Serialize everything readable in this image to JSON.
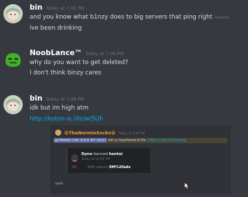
{
  "messages": [
    {
      "author": "bin",
      "timestamp": "Today at 7:06 PM",
      "lines": [
        "and you know what b1nzy does to big servers that ping right",
        "ive been drinking"
      ],
      "edited_label": "(edited)"
    },
    {
      "author": "NoobLance™",
      "timestamp": "Today at 7:06 PM",
      "lines": [
        "why do you want to get deleted?",
        "I don't think binzy cares"
      ]
    },
    {
      "author": "bin",
      "timestamp": "Today at 7:06 PM",
      "lines": [
        "idk but im high atm"
      ],
      "link": "http://koton-is.life/wi5Uh"
    }
  ],
  "embed": {
    "author": "TheNormieSocks",
    "author_emoji_left": "😀",
    "author_emoji_right": "😀",
    "timestamp": "Today at 7:07 PM",
    "highlight_mention": "@DRAMA CAN SUCK MY DICK!",
    "highlight_text": " tell ur boyfriend to fix",
    "highlight_link": "https://i.bin.tv/2i4.png",
    "mod_log": {
      "bot_name": "Dyno",
      "action_text": "banned",
      "target": "hentai",
      "time": "Today at 12:06 AM",
      "case_number": "01",
      "reason_prefix": "With reason",
      "reason": "DM%20ads"
    },
    "footer": "smh"
  },
  "colors": {
    "background": "#36393f",
    "link": "#00b0f4",
    "embed_user": "#f1a23c",
    "mention": "#5865a8"
  }
}
